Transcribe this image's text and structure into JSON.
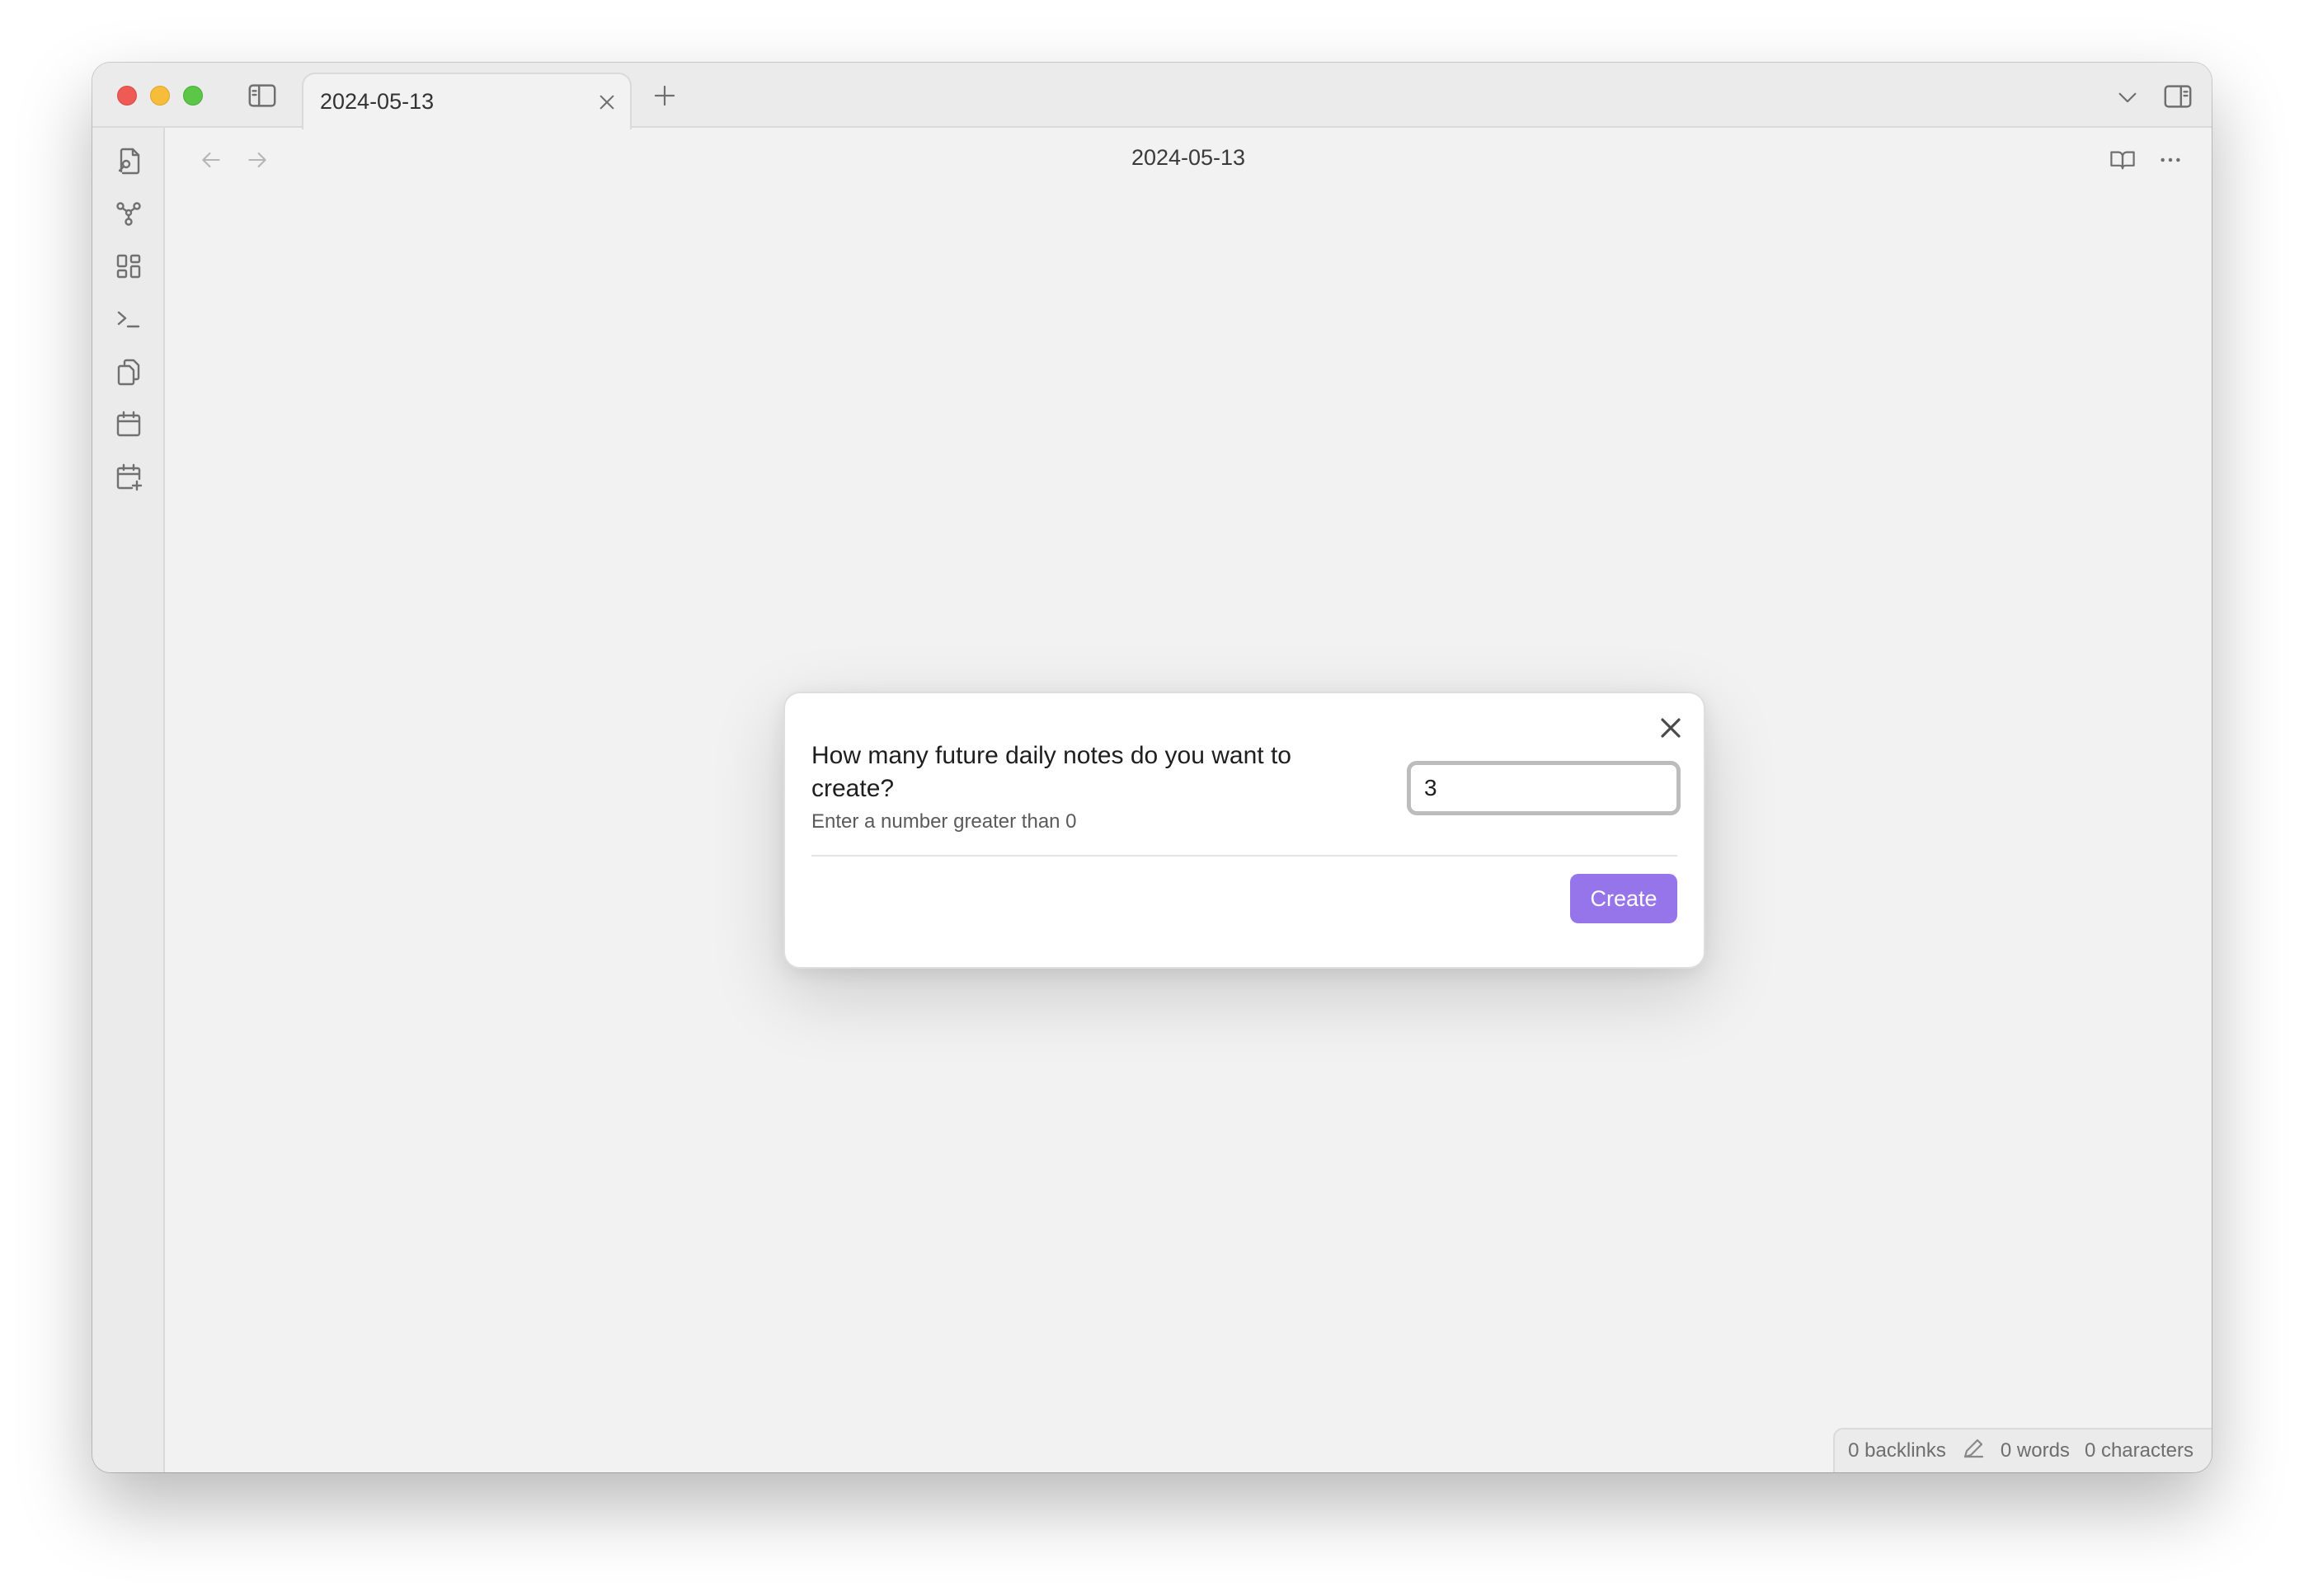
{
  "window": {
    "tab": {
      "title": "2024-05-13"
    },
    "view": {
      "title": "2024-05-13"
    },
    "statusbar": {
      "backlinks": "0 backlinks",
      "words": "0 words",
      "characters": "0 characters"
    }
  },
  "modal": {
    "setting_name": "How many future daily notes do you want to create?",
    "setting_desc": "Enter a number greater than 0",
    "input_value": "3",
    "create_label": "Create"
  },
  "ribbon_icons": [
    "open-quick-switcher-icon",
    "graph-view-icon",
    "canvas-icon",
    "command-palette-icon",
    "templates-icon",
    "daily-note-icon",
    "create-future-notes-icon"
  ],
  "colors": {
    "accent": "#9675eb",
    "background": "#f2f2f2",
    "chrome": "#ebebeb"
  }
}
